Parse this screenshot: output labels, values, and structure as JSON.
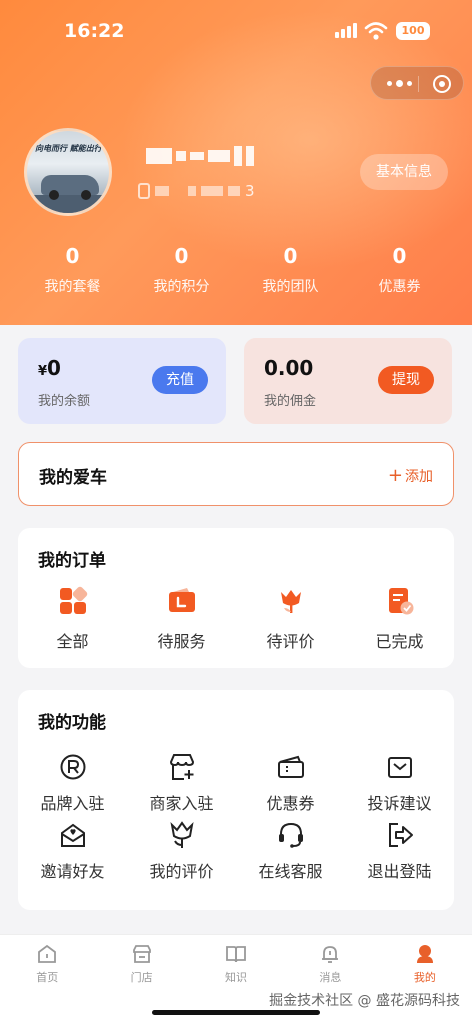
{
  "status": {
    "time": "16:22",
    "battery": "100"
  },
  "profile": {
    "avatar_slogan": "向电而行 赋能出行",
    "phone_tail": "3",
    "basic_info_button": "基本信息"
  },
  "stats": [
    {
      "value": "0",
      "label": "我的套餐"
    },
    {
      "value": "0",
      "label": "我的积分"
    },
    {
      "value": "0",
      "label": "我的团队"
    },
    {
      "value": "0",
      "label": "优惠券"
    }
  ],
  "wallet": {
    "balance": {
      "currency": "¥",
      "amount": "0",
      "label": "我的余额",
      "button": "充值"
    },
    "commission": {
      "amount": "0.00",
      "label": "我的佣金",
      "button": "提现"
    }
  },
  "my_car": {
    "title": "我的爱车",
    "add_label": "添加"
  },
  "orders": {
    "title": "我的订单",
    "items": [
      {
        "label": "全部",
        "icon": "grid-icon"
      },
      {
        "label": "待服务",
        "icon": "wallet-icon"
      },
      {
        "label": "待评价",
        "icon": "tulip-icon"
      },
      {
        "label": "已完成",
        "icon": "checked-document-icon"
      }
    ]
  },
  "functions": {
    "title": "我的功能",
    "items": [
      {
        "label": "品牌入驻",
        "icon": "registered-mark-icon"
      },
      {
        "label": "商家入驻",
        "icon": "store-add-icon"
      },
      {
        "label": "优惠券",
        "icon": "coupon-icon"
      },
      {
        "label": "投诉建议",
        "icon": "envelope-icon"
      },
      {
        "label": "邀请好友",
        "icon": "mail-heart-icon"
      },
      {
        "label": "我的评价",
        "icon": "tulip-outline-icon"
      },
      {
        "label": "在线客服",
        "icon": "headset-icon"
      },
      {
        "label": "退出登陆",
        "icon": "logout-icon"
      }
    ]
  },
  "tabbar": [
    {
      "label": "首页",
      "icon": "home-icon"
    },
    {
      "label": "门店",
      "icon": "store-icon"
    },
    {
      "label": "知识",
      "icon": "book-icon"
    },
    {
      "label": "消息",
      "icon": "bell-icon"
    },
    {
      "label": "我的",
      "icon": "person-icon",
      "active": true
    }
  ],
  "watermark": "掘金技术社区 @ 盛花源码科技",
  "colors": {
    "accent": "#e8602a",
    "recharge": "#4a79ee",
    "withdraw": "#f25a22",
    "hero": "#ff8a3d"
  }
}
